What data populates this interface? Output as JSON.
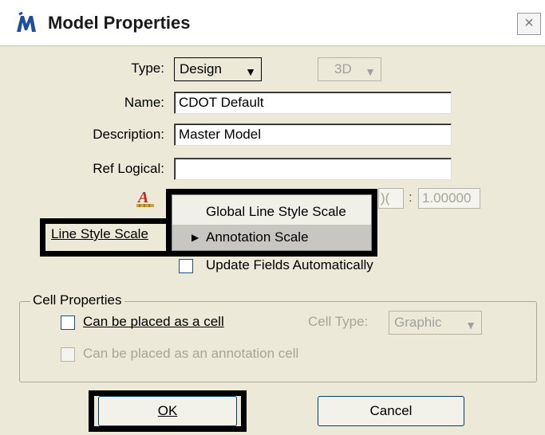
{
  "window": {
    "title": "Model Properties",
    "close_glyph": "×",
    "icon": "microstation-icon"
  },
  "type": {
    "label": "Type:",
    "value": "Design",
    "dim_value": "3D"
  },
  "name": {
    "label": "Name:",
    "value": "CDOT Default"
  },
  "description": {
    "label": "Description:",
    "value": "Master Model"
  },
  "ref_logical": {
    "label": "Ref Logical:",
    "value": ""
  },
  "annotation_scale": {
    "icon": "annotation-scale-icon",
    "value_partial": ")(",
    "colon": ":",
    "ratio_value": "1.00000"
  },
  "line_style_scale": {
    "label": "Line Style Scale"
  },
  "popup_menu": {
    "items": [
      {
        "label": "Global Line Style Scale",
        "selected": false
      },
      {
        "label": "Annotation Scale",
        "selected": true
      }
    ]
  },
  "update_fields": {
    "label": "Update Fields Automatically",
    "checked": false
  },
  "cell_properties": {
    "legend": "Cell Properties",
    "placed_as_cell": {
      "label": "Can be placed as a cell",
      "checked": false
    },
    "cell_type": {
      "label": "Cell Type:",
      "value": "Graphic"
    },
    "placed_as_annotation_cell": {
      "label": "Can be placed as an annotation cell",
      "checked": false
    }
  },
  "buttons": {
    "ok": "OK",
    "cancel": "Cancel"
  },
  "colors": {
    "dialog_bg": "#ece9d8",
    "highlight_frame": "#000000",
    "disabled_text": "#a8a596"
  }
}
